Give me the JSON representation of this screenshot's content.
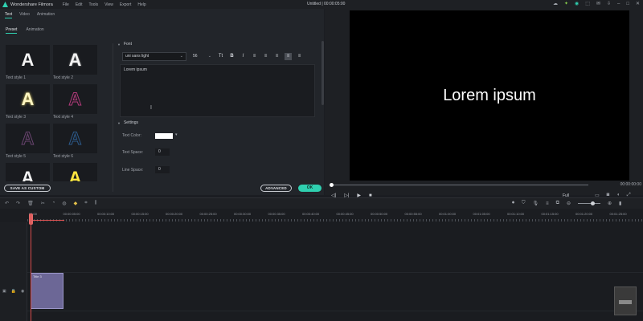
{
  "titlebar": {
    "app_name": "Wondershare Filmora",
    "menu": [
      "File",
      "Edit",
      "Tools",
      "View",
      "Export",
      "Help"
    ],
    "doc_title": "Untitled | 00:00:05:00"
  },
  "tabs": [
    "Text",
    "Video",
    "Animation"
  ],
  "subtabs": [
    "Preset",
    "Animation"
  ],
  "styles": [
    {
      "label": "Text style 1",
      "color": "#f2f2f2"
    },
    {
      "label": "Text style 2",
      "color": "#f2f2f2"
    },
    {
      "label": "Text style 3",
      "color": "#fff6c2"
    },
    {
      "label": "Text style 4",
      "color": "#b23a7a"
    },
    {
      "label": "Text style 5",
      "color": "#5a3a5e"
    },
    {
      "label": "Text style 6",
      "color": "#1e3a5c"
    },
    {
      "label": "",
      "color": "#f2f2f2"
    },
    {
      "label": "",
      "color": "#ffe640"
    }
  ],
  "font": {
    "section": "Font",
    "family": "uni sans light",
    "size": "56",
    "text": "Lorem ipsum"
  },
  "settings": {
    "section": "Settings",
    "text_color_label": "Text Color:",
    "text_color": "#ffffff",
    "text_space_label": "Text Space:",
    "text_space": "0",
    "line_space_label": "Line Space:",
    "line_space": "0"
  },
  "buttons": {
    "save_custom": "SAVE AS CUSTOM",
    "advanced": "ADVANCED",
    "ok": "OK"
  },
  "preview": {
    "text": "Lorem ipsum",
    "time": "00:00:00:00",
    "quality": "Full"
  },
  "ruler": [
    "00:00",
    "00:00:05:00",
    "00:00:10:00",
    "00:00:15:00",
    "00:00:20:00",
    "00:00:25:00",
    "00:00:30:00",
    "00:00:35:00",
    "00:00:40:00",
    "00:00:45:00",
    "00:00:50:00",
    "00:00:55:00",
    "00:01:00:00",
    "00:01:05:00",
    "00:01:10:00",
    "00:01:15:00",
    "00:01:20:00",
    "00:01:25:00"
  ],
  "clip": {
    "label": "Title 3"
  },
  "colors": {
    "accent": "#2fd0b0",
    "playhead": "#d64b4b",
    "clip": "#6c6796"
  }
}
